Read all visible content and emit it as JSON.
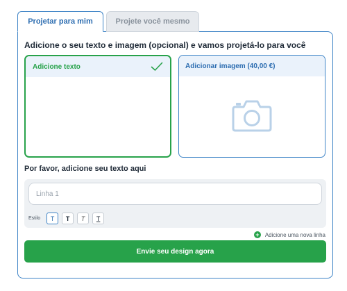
{
  "tabs": [
    {
      "label": "Projetar para mim",
      "active": true
    },
    {
      "label": "Projete você mesmo",
      "active": false
    }
  ],
  "headline": "Adicione o seu texto e imagem (opcional) e vamos projetá-lo para você",
  "cards": {
    "text": {
      "label": "Adicione texto",
      "selected": true,
      "icon": "check-icon"
    },
    "image": {
      "label": "Adicionar imagem (40,00 €)",
      "selected": false,
      "icon": "camera-icon"
    }
  },
  "subhead": "Por favor, adicione seu texto aqui",
  "line_input": {
    "value": "",
    "placeholder": "Linha 1"
  },
  "style": {
    "label": "Estilo",
    "buttons": [
      "T",
      "T",
      "T",
      "T"
    ]
  },
  "add_line": {
    "label": "Adicione uma nova linha",
    "icon": "plus-circle-icon"
  },
  "submit": {
    "label": "Envie seu design agora"
  },
  "colors": {
    "accent_green": "#27a24a",
    "accent_blue": "#3d83c6",
    "card_header_bg": "#eaf2fb",
    "camera": "#b9d1e8"
  }
}
